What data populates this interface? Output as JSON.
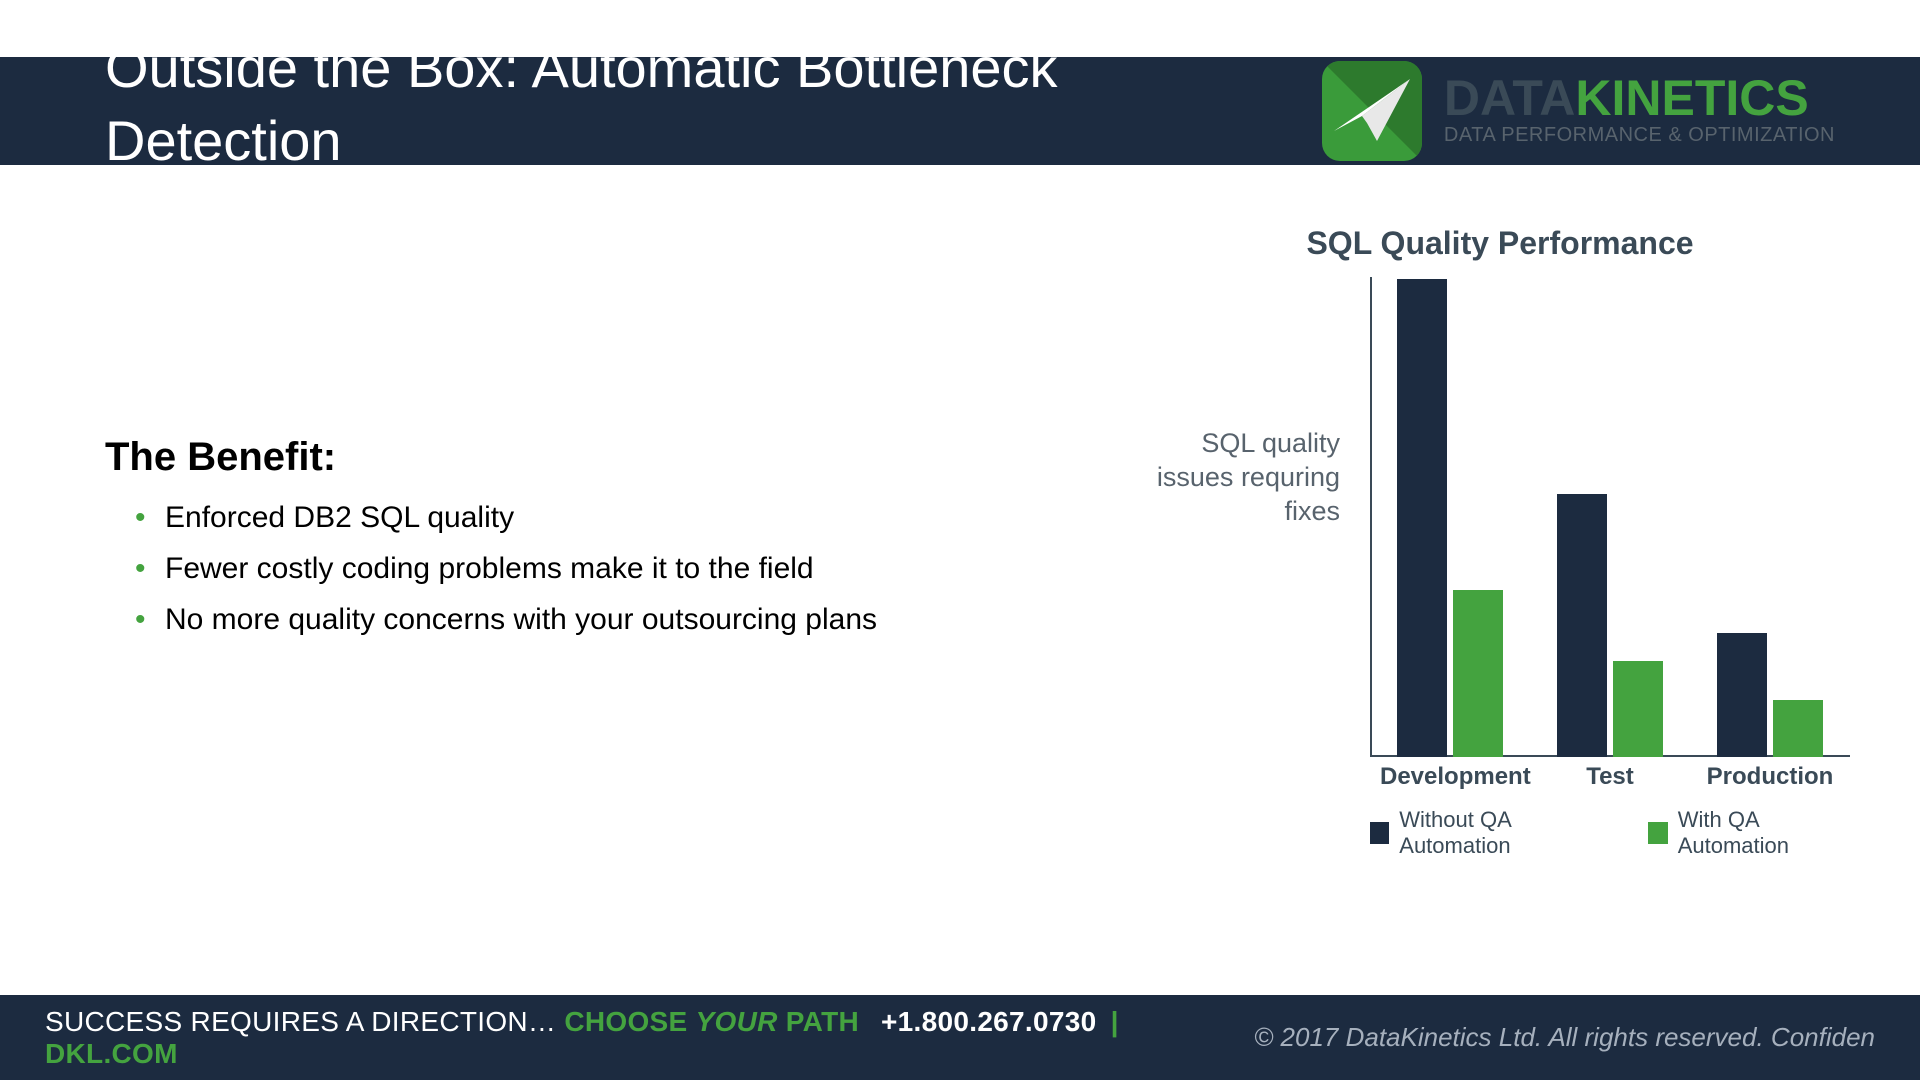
{
  "header": {
    "title": "Outside the Box: Automatic Bottleneck Detection"
  },
  "logo": {
    "word1": "DATA",
    "word2": "KINETICS",
    "tagline": "DATA PERFORMANCE & OPTIMIZATION"
  },
  "benefit": {
    "heading": "The Benefit:",
    "items": [
      "Enforced DB2 SQL quality",
      "Fewer costly coding problems make it to the field",
      "No more quality concerns with your outsourcing plans"
    ]
  },
  "chart_data": {
    "type": "bar",
    "title": "SQL Quality Performance",
    "ylabel": "SQL quality issues requring fixes",
    "xlabel": "",
    "categories": [
      "Development",
      "Test",
      "Production"
    ],
    "series": [
      {
        "name": "Without QA Automation",
        "values": [
          100,
          55,
          26
        ]
      },
      {
        "name": "With QA Automation",
        "values": [
          35,
          20,
          12
        ]
      }
    ],
    "ylim": [
      0,
      100
    ]
  },
  "footer": {
    "s1": "SUCCESS REQUIRES A DIRECTION… ",
    "s2": "CHOOSE ",
    "s3": "YOUR ",
    "s4": "PATH",
    "phone": "+1.800.267.0730",
    "sep": " | ",
    "site": "DKL.COM",
    "copyright": "© 2017 DataKinetics Ltd.   All rights reserved. Confiden"
  }
}
